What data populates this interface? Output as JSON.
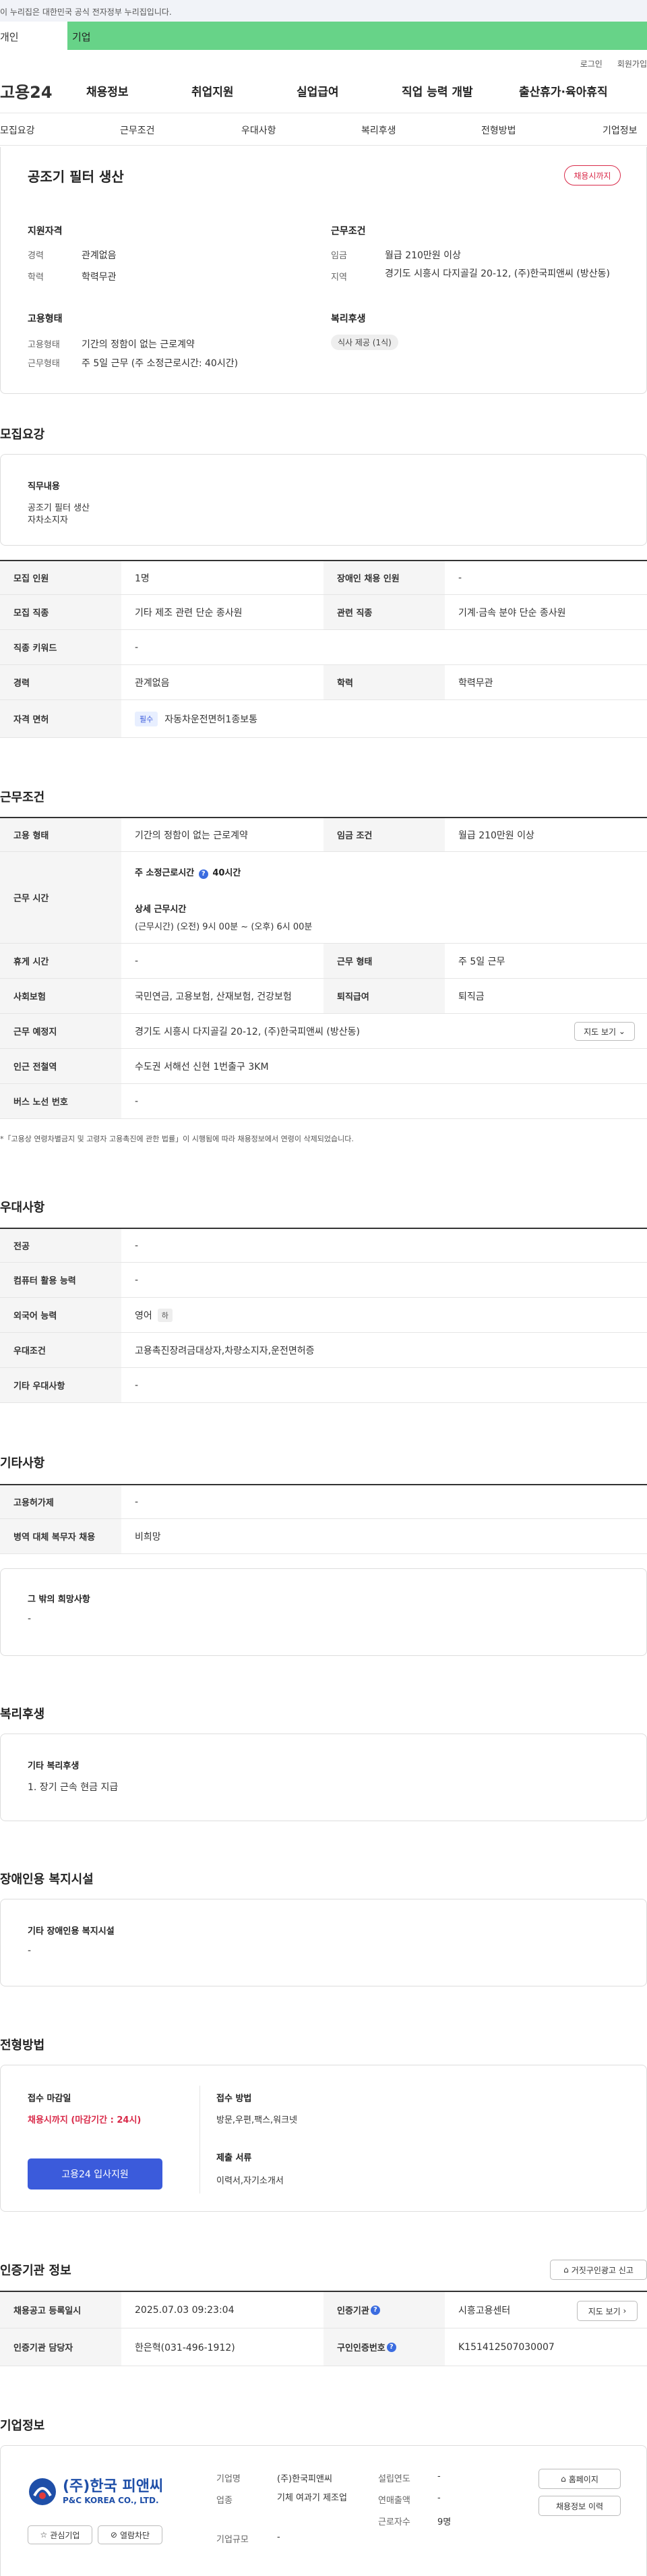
{
  "gov_banner": "이 누리집은 대한민국 공식 전자정부 누리집입니다.",
  "tabs": [
    "개인",
    "기업"
  ],
  "util": [
    "로그인",
    "회원가입"
  ],
  "gnb": {
    "logo": "고용24",
    "menus": [
      "채용정보",
      "취업지원",
      "실업급여",
      "직업 능력 개발",
      "출산휴가·육아휴직"
    ]
  },
  "subnav": [
    "모집요강",
    "근무조건",
    "우대사항",
    "복리후생",
    "전형방법",
    "기업정보"
  ],
  "summary": {
    "title": "공조기 필터 생산",
    "status": "채용시까지",
    "qual_head": "지원자격",
    "career_label": "경력",
    "career_value": "관계없음",
    "edu_label": "학력",
    "edu_value": "학력무관",
    "emp_head": "고용형태",
    "emptype_label": "고용형태",
    "emptype_value": "기간의 정함이 없는 근로계약",
    "work_label": "근무형태",
    "work_value": "주 5일 근무 (주 소정근로시간: 40시간)",
    "cond_head": "근무조건",
    "wage_label": "임금",
    "wage_value": "월급 210만원 이상",
    "region_label": "지역",
    "region_value": "경기도 시흥시 다지골길 20-12, (주)한국피앤씨 (방산동)",
    "welfare_head": "복리후생",
    "welfare_pill": "식사 제공 (1식)"
  },
  "recruit": {
    "title": "모집요강",
    "duty_head": "직무내용",
    "duty_lines": [
      "공조기 필터 생산",
      "자차소지자"
    ],
    "rows": [
      {
        "h1": "모집 인원",
        "v1": "1명",
        "h2": "장애인 채용 인원",
        "v2": "-"
      },
      {
        "h1": "모집 직종",
        "v1": "기타 제조 관련 단순 종사원",
        "h2": "관련 직종",
        "v2": "기계·금속 분야 단순 종사원"
      },
      {
        "h1": "직종 키워드",
        "v1": "-"
      },
      {
        "h1": "경력",
        "v1": "관계없음",
        "h2": "학력",
        "v2": "학력무관"
      }
    ],
    "license_head": "자격 면허",
    "license_badge": "필수",
    "license_value": "자동차운전면허1종보통"
  },
  "conditions": {
    "title": "근무조건",
    "emptype_h": "고용 형태",
    "emptype_v": "기간의 정함이 없는 근로계약",
    "wage_h": "임금 조건",
    "wage_v": "월급 210만원 이상",
    "hours_h": "근무 시간",
    "hours_weekly": "주 소정근로시간",
    "hours_weekly_v": "40시간",
    "hours_detail_h": "상세 근무시간",
    "hours_detail_v": "(근무시간) (오전) 9시 00분 ~ (오후) 6시 00분",
    "rest_h": "휴게 시간",
    "rest_v": "-",
    "worktype_h": "근무 형태",
    "worktype_v": "주 5일 근무",
    "insurance_h": "사회보험",
    "insurance_v": "국민연금, 고용보험, 산재보험, 건강보험",
    "severance_h": "퇴직급여",
    "severance_v": "퇴직금",
    "place_h": "근무 예정지",
    "place_v": "경기도 시흥시 다지골길 20-12, (주)한국피앤씨 (방산동)",
    "map_btn": "지도 보기",
    "subway_h": "인근 전철역",
    "subway_v": "수도권 서해선 신현 1번출구 3KM",
    "bus_h": "버스 노선 번호",
    "bus_v": "-",
    "notice": "*「고용상 연령차별금지 및 고령자 고용촉진에 관한 법률」이 시행됨에 따라 채용정보에서 연령이 삭제되었습니다."
  },
  "prefs": {
    "title": "우대사항",
    "rows": [
      {
        "h": "전공",
        "v": "-"
      },
      {
        "h": "컴퓨터 활용 능력",
        "v": "-"
      },
      {
        "h": "외국어 능력",
        "v": "영어",
        "badge": "하"
      },
      {
        "h": "우대조건",
        "v": "고용촉진장려금대상자,차량소지자,운전면허증"
      },
      {
        "h": "기타 우대사항",
        "v": "-"
      }
    ]
  },
  "etc": {
    "title": "기타사항",
    "rows": [
      {
        "h": "고용허가제",
        "v": "-"
      },
      {
        "h": "병역 대체 복무자 채용",
        "v": "비희망"
      }
    ],
    "other_head": "그 밖의 희망사항",
    "other_value": "-"
  },
  "welfare": {
    "title": "복리후생",
    "head": "기타 복리후생",
    "value": "1. 장기 근속 현금 지급"
  },
  "disability": {
    "title": "장애인용 복지시설",
    "head": "기타 장애인용 복지시설",
    "value": "-"
  },
  "screening": {
    "title": "전형방법",
    "deadline_h": "접수 마감일",
    "deadline_v": "채용시까지 (마감기간 : 24시)",
    "apply_btn": "고용24 입사지원",
    "method_h": "접수 방법",
    "method_v": "방문,우편,팩스,워크넷",
    "docs_h": "제출 서류",
    "docs_v": "이력서,자기소개서"
  },
  "agency": {
    "title": "인증기관 정보",
    "report_btn": "거짓구인광고 신고",
    "reg_h": "채용공고 등록일시",
    "reg_v": "2025.07.03 09:23:04",
    "org_h": "인증기관",
    "org_v": "시흥고용센터",
    "map_btn": "지도 보기",
    "mgr_h": "인증기관 담당자",
    "mgr_v": "한은혁(031-496-1912)",
    "num_h": "구인인증번호",
    "num_v": "K151412507030007"
  },
  "company": {
    "title": "기업정보",
    "logo_kr": "(주)한국 피앤씨",
    "logo_en": "P&C KOREA CO., LTD.",
    "fav_btn": "관심기업",
    "block_btn": "열람차단",
    "name_h": "기업명",
    "name_v": "(주)한국피앤씨",
    "industry_h": "업종",
    "industry_v": "기체 여과기 제조업",
    "size_h": "기업규모",
    "size_v": "-",
    "founded_h": "설립연도",
    "founded_v": "-",
    "sales_h": "연매출액",
    "sales_v": "-",
    "staff_h": "근로자수",
    "staff_v": "9명",
    "home_btn": "홈페이지",
    "history_btn": "채용정보 이력"
  },
  "colors": {
    "brand_green": "#67d388",
    "accent_blue": "#3b5bdb",
    "alert_red": "#d92b4a"
  }
}
